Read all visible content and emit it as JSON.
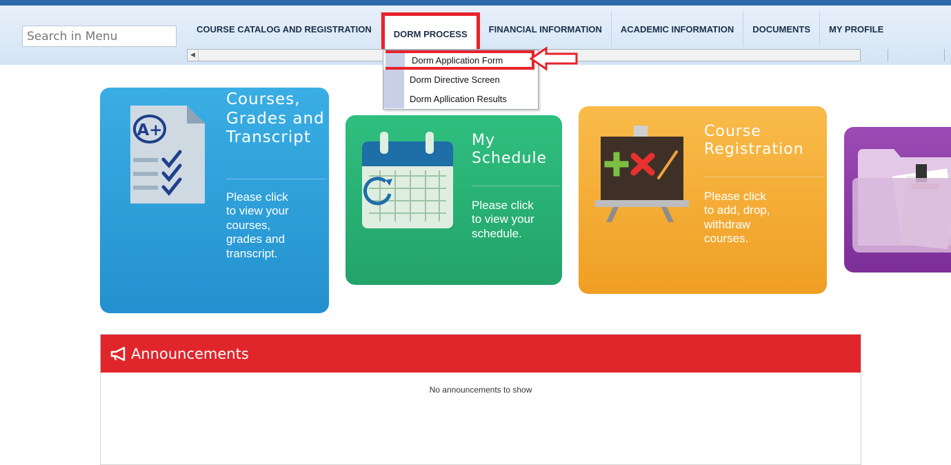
{
  "search": {
    "placeholder": "Search in Menu"
  },
  "nav": {
    "items": [
      {
        "label": "COURSE CATALOG AND REGISTRATION"
      },
      {
        "label": "DORM PROCESS"
      },
      {
        "label": "FINANCIAL INFORMATION"
      },
      {
        "label": "ACADEMIC INFORMATION"
      },
      {
        "label": "DOCUMENTS"
      },
      {
        "label": "MY PROFILE"
      }
    ]
  },
  "dropdown": {
    "items": [
      {
        "label": "Dorm Application Form"
      },
      {
        "label": "Dorm Directive Screen"
      },
      {
        "label": "Dorm Apllication Results"
      }
    ]
  },
  "tiles": {
    "courses": {
      "title": "Courses, Grades and Transcript",
      "desc": "Please click to view your courses, grades and transcript.",
      "icon": "report-card-icon"
    },
    "schedule": {
      "title": "My Schedule",
      "desc": "Please click to view your schedule.",
      "icon": "calendar-icon"
    },
    "registration": {
      "title": "Course Registration",
      "desc": "Please click to add, drop, withdraw courses.",
      "icon": "chalkboard-icon"
    },
    "documents": {
      "icon": "folder-icon"
    }
  },
  "announcements": {
    "title": "Announcements",
    "empty": "No announcements to show",
    "icon": "megaphone-icon"
  },
  "colors": {
    "accent_red": "#e8222b",
    "header_blue": "#2f6aa8"
  }
}
